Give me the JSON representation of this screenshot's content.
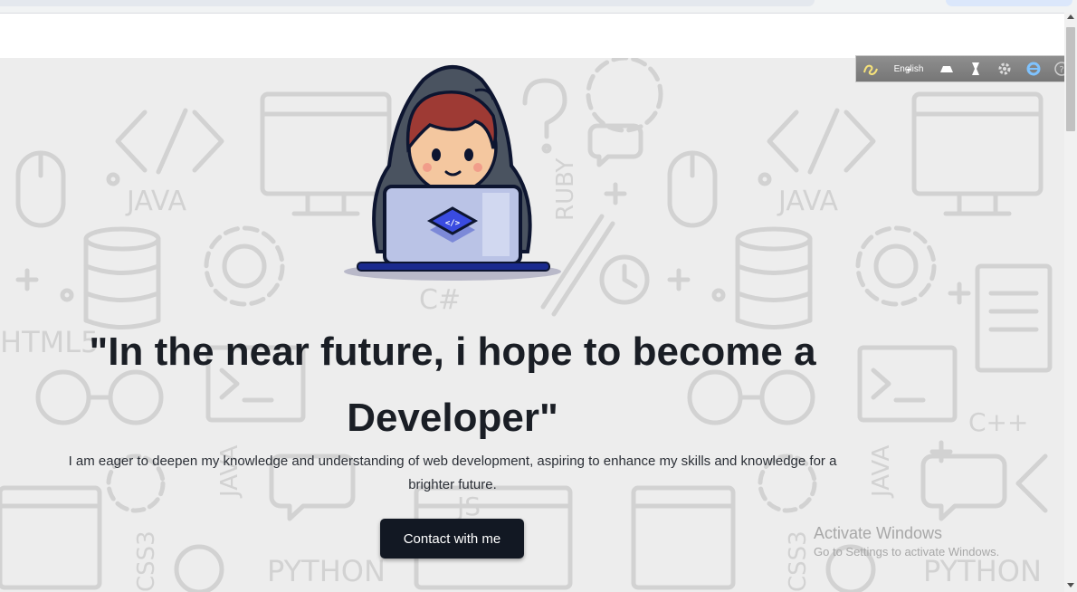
{
  "hero": {
    "headline": "\"In the near future, i hope to become a Developer\"",
    "subtitle": "I am eager to deepen my knowledge and understanding of web development, aspiring to enhance my skills and knowledge for a brighter future.",
    "cta_label": "Contact with me",
    "background_words": [
      "JAVA",
      "RUBY",
      "C#",
      "HTML5",
      "JS",
      "C++",
      "CSS3",
      "PYTHON",
      "JAVA",
      "PYTHON",
      "CSS3",
      "JAVA"
    ]
  },
  "toolbar": {
    "language": "English",
    "icons": [
      "logo-icon",
      "keyboard-icon",
      "font-icon",
      "settings-icon",
      "browser-icon",
      "help-icon"
    ]
  },
  "watermark": {
    "title": "Activate Windows",
    "subtitle": "Go to Settings to activate Windows."
  },
  "colors": {
    "page_bg": "#ededed",
    "doodle": "#d2d2d2",
    "heading": "#1a1e25",
    "button": "#121823",
    "hood": "#4a5360",
    "hair": "#9e3a34",
    "laptop": "#bac3e6",
    "logo": "#3a4be0"
  }
}
